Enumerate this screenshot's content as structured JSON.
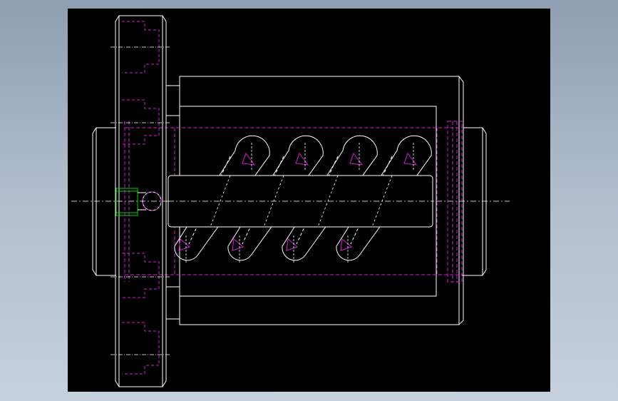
{
  "colors": {
    "background_gradient_top": "#8e9fb2",
    "background_gradient_bottom": "#c6d1dc",
    "viewport_background": "#000000",
    "outline": "#ffffff",
    "hidden_lines": "#d81bd8",
    "set_screw_highlight": "#00d000",
    "centerlines": "#ffffff"
  },
  "drawing": {
    "view": "side-elevation",
    "groove_count": 4,
    "has_flange": true,
    "has_set_screw": true
  }
}
